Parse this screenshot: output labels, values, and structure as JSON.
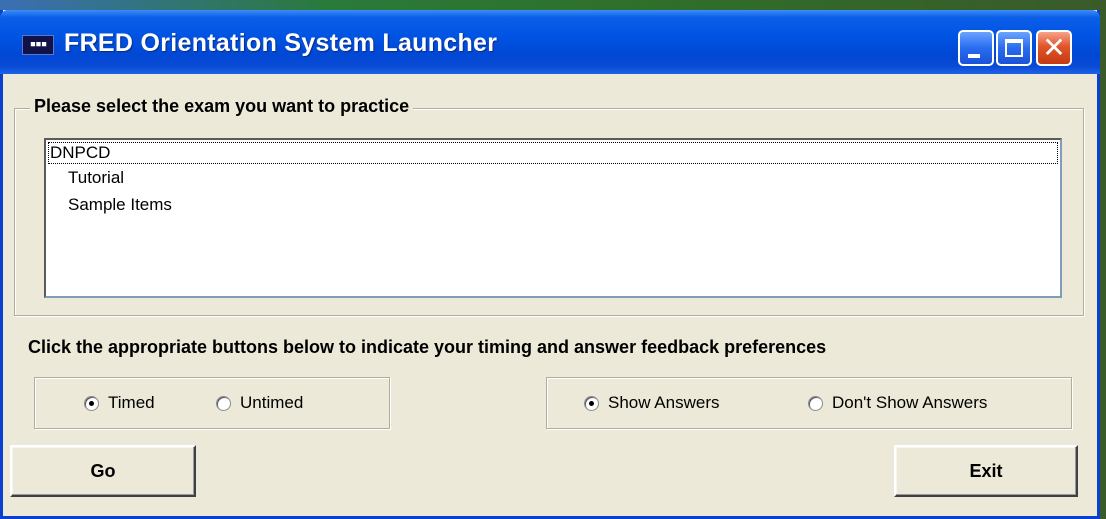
{
  "window": {
    "title": "FRED Orientation System Launcher",
    "icon_text": "▪▪▪"
  },
  "exam_group": {
    "legend": "Please select the exam you want to practice",
    "items": [
      {
        "label": "DNPCD",
        "selected": true
      },
      {
        "label": "Tutorial",
        "selected": false
      },
      {
        "label": "Sample Items",
        "selected": false
      }
    ]
  },
  "instructions": "Click the appropriate buttons below to indicate your timing and answer feedback preferences",
  "timing": {
    "options": [
      {
        "label": "Timed",
        "checked": true
      },
      {
        "label": "Untimed",
        "checked": false
      }
    ]
  },
  "answers": {
    "options": [
      {
        "label": "Show Answers",
        "checked": true
      },
      {
        "label": "Don't Show Answers",
        "checked": false
      }
    ]
  },
  "buttons": {
    "go_label": "Go",
    "exit_label": "Exit"
  },
  "colors": {
    "titlebar": "#0054e3",
    "window_bg": "#ece9d8",
    "close_button": "#e2552a"
  }
}
